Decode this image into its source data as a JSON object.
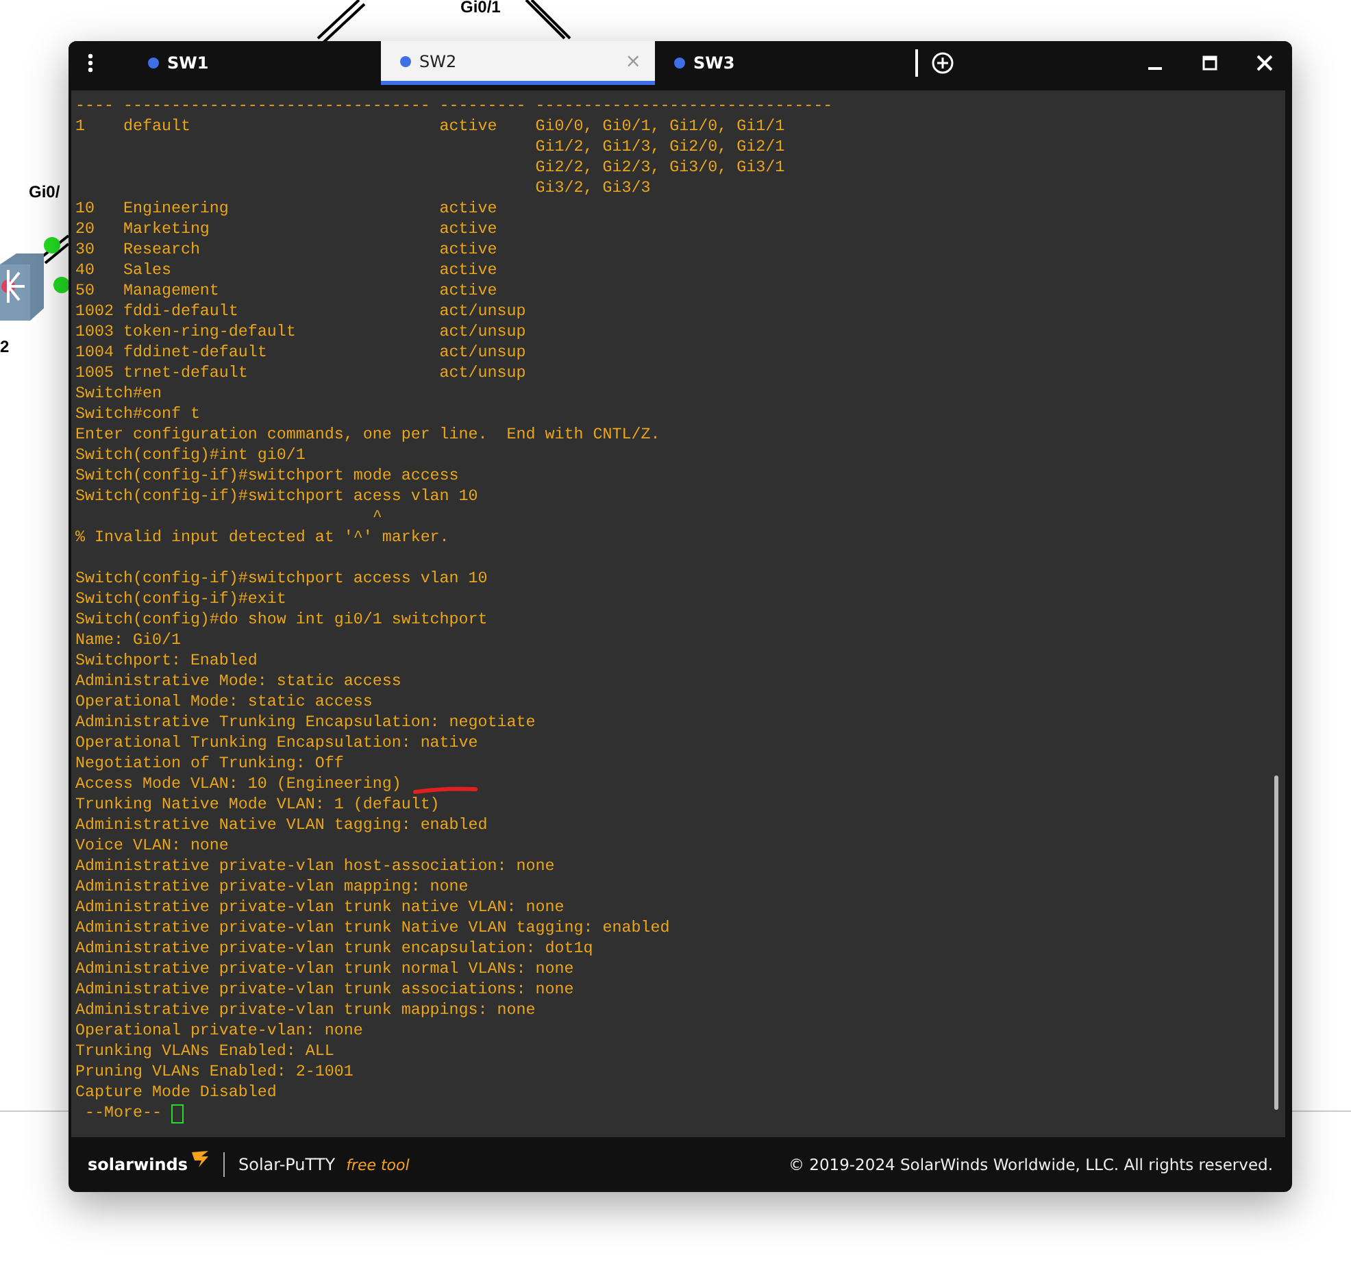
{
  "background": {
    "labels": [
      {
        "text": "Gi0/1",
        "kind": "top"
      },
      {
        "text": "Gi0/",
        "kind": "left"
      },
      {
        "text": "2",
        "kind": "device"
      }
    ]
  },
  "window": {
    "tabs": [
      {
        "label": "SW1",
        "selected": false
      },
      {
        "label": "SW2",
        "selected": true,
        "close": "×"
      },
      {
        "label": "SW3",
        "selected": false
      }
    ]
  },
  "terminal": {
    "blocks": [
      [
        "---- -------------------------------- --------- -------------------------------",
        "1    default                          active    Gi0/0, Gi0/1, Gi1/0, Gi1/1",
        "                                                Gi1/2, Gi1/3, Gi2/0, Gi2/1",
        "                                                Gi2/2, Gi2/3, Gi3/0, Gi3/1",
        "                                                Gi3/2, Gi3/3",
        "10   Engineering                      active",
        "20   Marketing                        active",
        "30   Research                         active",
        "40   Sales                            active",
        "50   Management                       active",
        "1002 fddi-default                     act/unsup",
        "1003 token-ring-default               act/unsup",
        "1004 fddinet-default                  act/unsup",
        "1005 trnet-default                    act/unsup",
        "Switch#en",
        "Switch#conf t",
        "Enter configuration commands, one per line.  End with CNTL/Z.",
        "Switch(config)#int gi0/1",
        "Switch(config-if)#switchport mode access",
        "Switch(config-if)#switchport acess vlan 10",
        "                               ^",
        "% Invalid input detected at '^' marker."
      ],
      [
        "Switch(config-if)#switchport access vlan 10",
        "Switch(config-if)#exit",
        "Switch(config)#do show int gi0/1 switchport",
        "Name: Gi0/1",
        "Switchport: Enabled",
        "Administrative Mode: static access",
        "Operational Mode: static access",
        "Administrative Trunking Encapsulation: negotiate",
        "Operational Trunking Encapsulation: native",
        "Negotiation of Trunking: Off",
        {
          "text": "Access Mode VLAN: 10 (Engineering)",
          "kind": "underlined"
        },
        "Trunking Native Mode VLAN: 1 (default)",
        "Administrative Native VLAN tagging: enabled",
        "Voice VLAN: none",
        "Administrative private-vlan host-association: none",
        "Administrative private-vlan mapping: none",
        "Administrative private-vlan trunk native VLAN: none",
        "Administrative private-vlan trunk Native VLAN tagging: enabled",
        "Administrative private-vlan trunk encapsulation: dot1q",
        "Administrative private-vlan trunk normal VLANs: none",
        "Administrative private-vlan trunk associations: none",
        "Administrative private-vlan trunk mappings: none",
        "Operational private-vlan: none",
        "Trunking VLANs Enabled: ALL",
        "Pruning VLANs Enabled: 2-1001",
        "Capture Mode Disabled"
      ]
    ],
    "more_prompt": " --More-- "
  },
  "footer": {
    "brand": "solarwinds",
    "product": "Solar-PuTTY",
    "tag": "free tool",
    "copyright": "© 2019-2024 SolarWinds Worldwide, LLC. All rights reserved."
  }
}
